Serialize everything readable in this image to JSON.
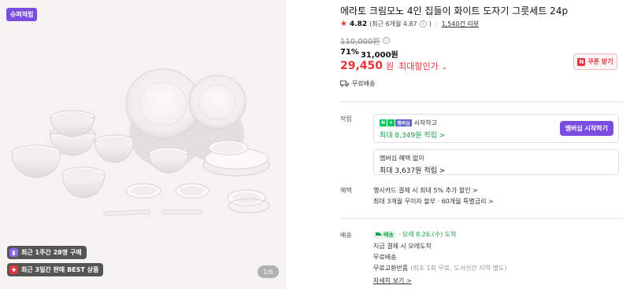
{
  "image": {
    "badge": "슈퍼적립",
    "pill1": "최근 1주간 28명 구매",
    "pill2": "최근 3일간 판매 BEST 상품",
    "pager": "1/6"
  },
  "product": {
    "title": "에라토 크림모노 4인 집들이 화이트 도자기 그릇세트 24p",
    "rating_score": "4.82",
    "rating_detail": "(최근 6개월 4.87",
    "review_count": "1,540건 리뷰",
    "original_price": "110,000원",
    "discount_pct": "71%",
    "discount_price": "31,000원",
    "final_price": "29,450",
    "final_won": "원",
    "max_discount_label": "최대할인가",
    "coupon_label": "쿠폰 받기",
    "shipping_label": "무료배송"
  },
  "points": {
    "section_label": "적립",
    "member_start": "시작하고",
    "member_max_prefix": "최대 ",
    "member_max_value": "8,349원 적립 >",
    "member_button": "멤버십 시작하기",
    "nonmember_title": "멤버십 혜택 없이",
    "nonmember_value": "최대 3,637원 적립 >"
  },
  "benefits": {
    "section_label": "혜택",
    "line1": "행사카드 결제 시 최대 5% 추가 할인 >",
    "line2": "최대 3개월 무이자 할부 · 60개월 특별금리 >"
  },
  "delivery": {
    "section_label": "배송",
    "tag": "배송",
    "arrival": "· 모레 8.26.(수) 도착",
    "line2": "지금 결제 시 모레도착",
    "line3": "무료배송",
    "line4_main": "무료교환반품",
    "line4_note": "(최초 1회 무료, 도서산간 지역 별도)",
    "more": "자세히 보기 >"
  },
  "colors": {
    "accent_purple": "#7b4ce0",
    "price_red": "#e4343c",
    "npay_green": "#03c75a"
  }
}
